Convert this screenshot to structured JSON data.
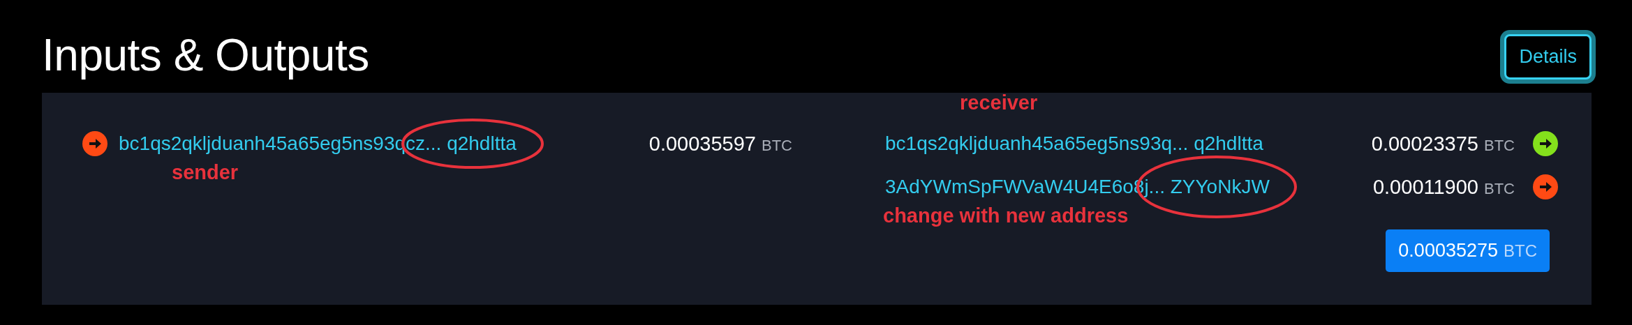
{
  "title": "Inputs & Outputs",
  "details_button": "Details",
  "inputs": [
    {
      "address": "bc1qs2qkljduanh45a65eg5ns93qcz... q2hdltta",
      "amount": "0.00035597",
      "unit": "BTC",
      "color": "#ff4a14",
      "circled": true,
      "label_below": "sender"
    }
  ],
  "outputs": [
    {
      "address": "bc1qs2qkljduanh45a65eg5ns93q... q2hdltta",
      "amount": "0.00023375",
      "unit": "BTC",
      "color": "#84e01c",
      "circled": false,
      "label_above": "receiver"
    },
    {
      "address": "3AdYWmSpFWVaW4U4E6o8j... ZYYoNkJW",
      "amount": "0.00011900",
      "unit": "BTC",
      "color": "#ff4a14",
      "circled": true,
      "label_below": "change with new address"
    }
  ],
  "total": {
    "amount": "0.00035275",
    "unit": "BTC"
  }
}
